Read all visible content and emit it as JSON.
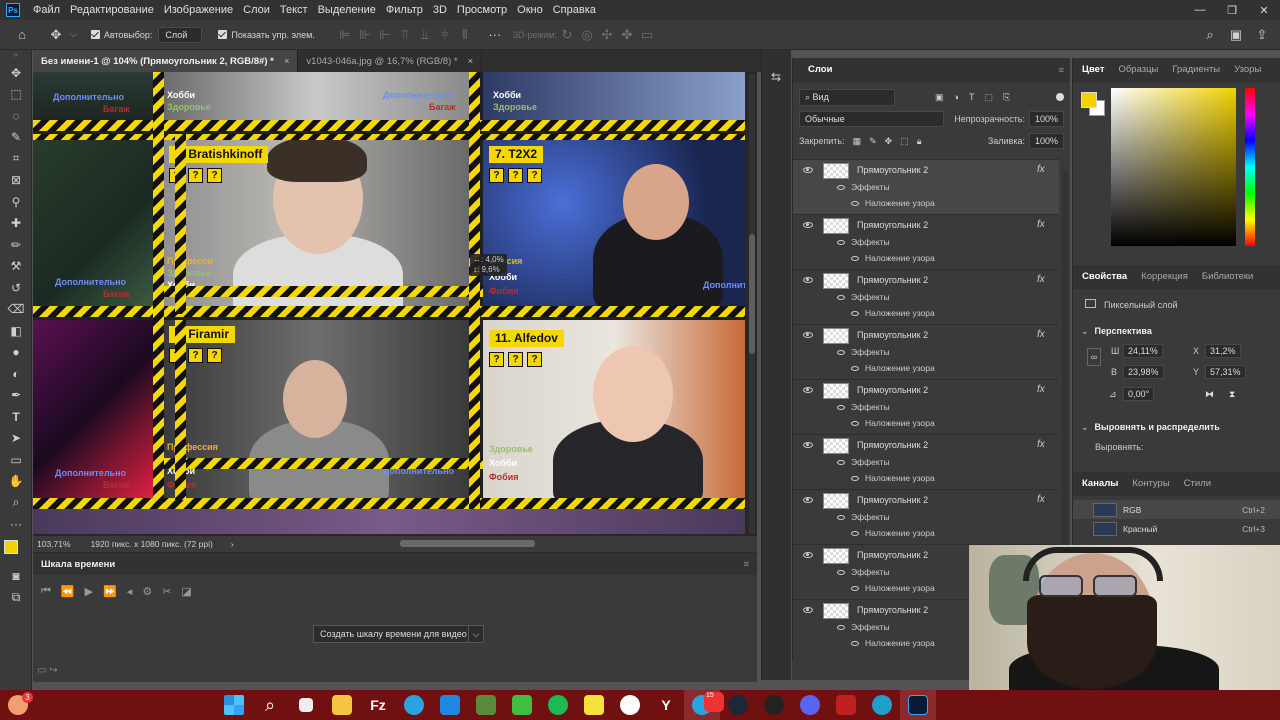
{
  "menu": {
    "logo": "Ps",
    "items": [
      "Файл",
      "Редактирование",
      "Изображение",
      "Слои",
      "Текст",
      "Выделение",
      "Фильтр",
      "3D",
      "Просмотр",
      "Окно",
      "Справка"
    ]
  },
  "window_controls": {
    "minimize": "—",
    "maximize": "❐",
    "close": "✕"
  },
  "options": {
    "autoselect_label": "Автовыбор:",
    "autoselect_value": "Слой",
    "show_controls_label": "Показать упр. элем.",
    "mode_3d_label": "3D-режим:"
  },
  "tabs": [
    {
      "label": "Без имени-1 @ 104% (Прямоугольник 2, RGB/8#) *",
      "close": "×"
    },
    {
      "label": "v1043-046a.jpg @ 16,7% (RGB/8) *",
      "close": "×"
    }
  ],
  "canvas": {
    "tiles": {
      "t6": {
        "name": "6. Bratishkinoff"
      },
      "t7": {
        "name": "7. T2X2"
      },
      "t10": {
        "name": "0. Firamir"
      },
      "t11": {
        "name": "11. Alfedov"
      }
    },
    "overlay_words": {
      "hobby": "Хобби",
      "health": "Здоровье",
      "extra": "Дополнительно",
      "baggage": "Багаж",
      "profession": "Профессия",
      "profession_short": "Професси",
      "profession_partial": "фессия",
      "phobia": "Фобия",
      "question": "?"
    },
    "measure": {
      "w": "↔: 4,0%",
      "h": "↕: 9,6%"
    }
  },
  "status": {
    "zoom": "103,71%",
    "doc_size": "1920 пикс. x 1080 пикс. (72 ppi)",
    "arrow": "›"
  },
  "timeline": {
    "title": "Шкала времени",
    "create_button": "Создать шкалу времени для видео",
    "dd": "⌵"
  },
  "layers_panel": {
    "tab": "Слои",
    "search_kind": "Вид",
    "blend_mode": "Обычные",
    "opacity_label": "Непрозрачность:",
    "opacity_value": "100%",
    "lock_label": "Закрепить:",
    "fill_label": "Заливка:",
    "fill_value": "100%",
    "layers": [
      {
        "name": "Прямоугольник 2",
        "fx": "fx",
        "effects": "Эффекты",
        "pattern": "Наложение узора"
      },
      {
        "name": "Прямоугольник 2",
        "fx": "fx",
        "effects": "Эффекты",
        "pattern": "Наложение узора"
      },
      {
        "name": "Прямоугольник 2",
        "fx": "fx",
        "effects": "Эффекты",
        "pattern": "Наложение узора"
      },
      {
        "name": "Прямоугольник 2",
        "fx": "fx",
        "effects": "Эффекты",
        "pattern": "Наложение узора"
      },
      {
        "name": "Прямоугольник 2",
        "fx": "fx",
        "effects": "Эффекты",
        "pattern": "Наложение узора"
      },
      {
        "name": "Прямоугольник 2",
        "fx": "fx",
        "effects": "Эффекты",
        "pattern": "Наложение узора"
      },
      {
        "name": "Прямоугольник 2",
        "fx": "fx",
        "effects": "Эффекты",
        "pattern": "Наложение узора"
      },
      {
        "name": "Прямоугольник 2",
        "fx": "fx",
        "effects": "Эффекты",
        "pattern": "Наложение узора"
      },
      {
        "name": "Прямоугольник 2",
        "fx": "fx",
        "effects": "Эффекты",
        "pattern": "Наложение узора"
      }
    ]
  },
  "color_panel": {
    "tabs": [
      "Цвет",
      "Образцы",
      "Градиенты",
      "Узоры"
    ],
    "foreground": "#f2d200"
  },
  "properties": {
    "tabs": [
      "Свойства",
      "Коррекция",
      "Библиотеки"
    ],
    "layer_type": "Пиксельный слой",
    "transform_header": "Перспектива",
    "w_label": "Ш",
    "w_value": "24,11%",
    "h_label": "В",
    "h_value": "23,98%",
    "x_label": "X",
    "x_value": "31,2%",
    "y_label": "Y",
    "y_value": "57,31%",
    "angle_value": "0,00°",
    "align_header": "Выровнять и распределить",
    "align_label": "Выровнять:"
  },
  "channels": {
    "tabs": [
      "Каналы",
      "Контуры",
      "Стили"
    ],
    "rows": [
      {
        "name": "RGB",
        "key": "Ctrl+2"
      },
      {
        "name": "Красный",
        "key": "Ctrl+3"
      }
    ]
  },
  "taskbar": {
    "badge_count": "3",
    "telegram_badge": "15"
  }
}
